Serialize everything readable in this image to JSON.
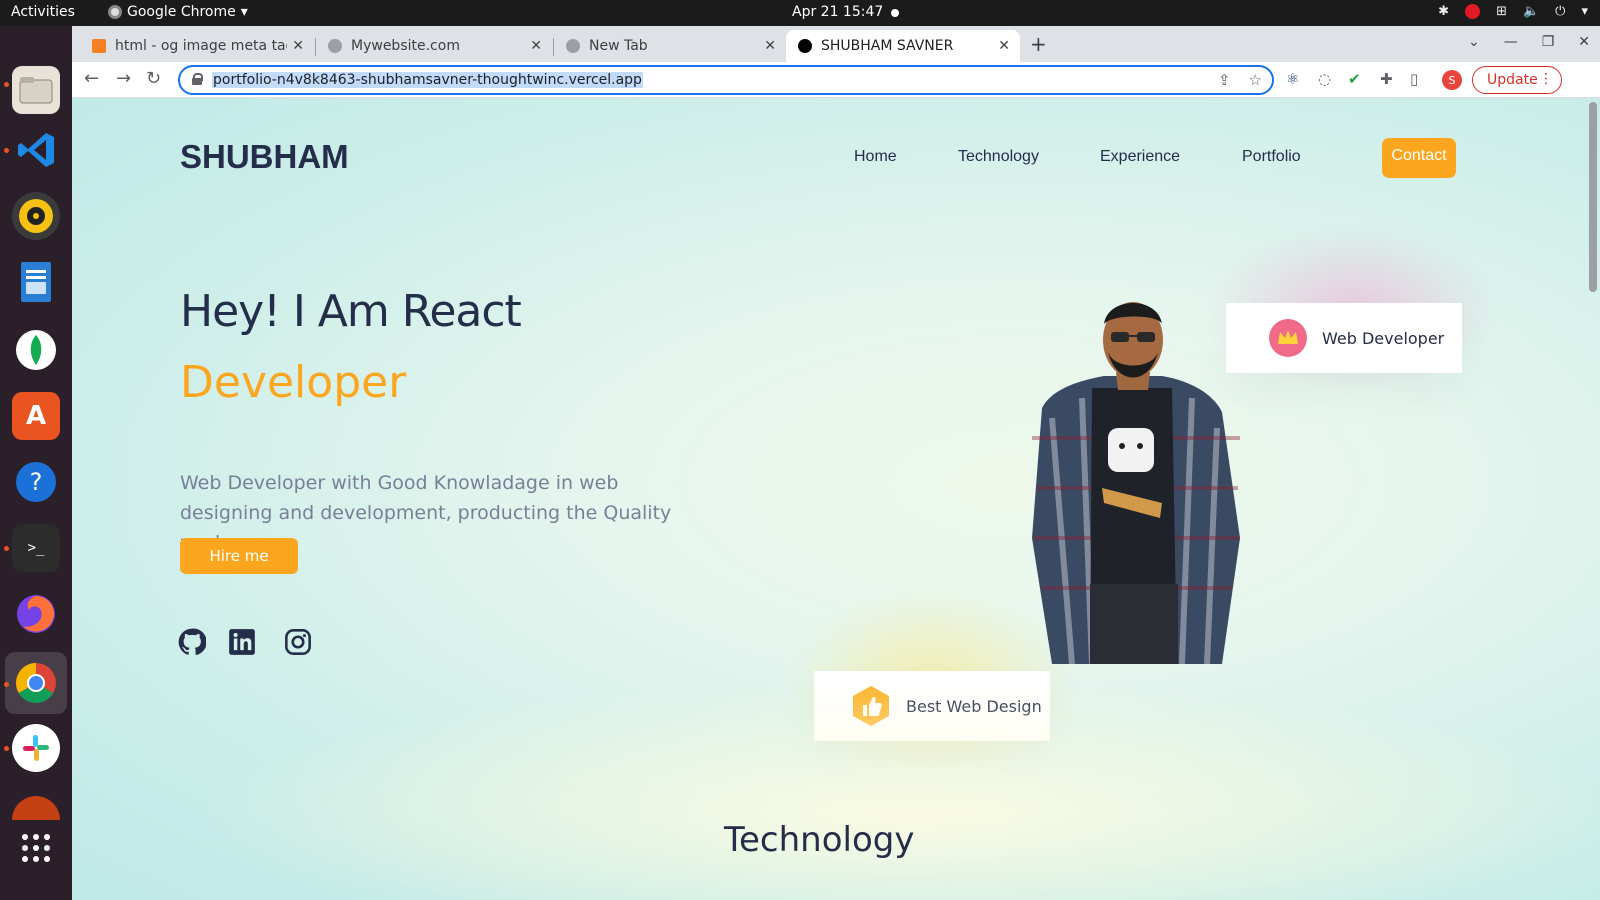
{
  "topbar": {
    "activities": "Activities",
    "app_name": "Google Chrome",
    "clock": "Apr 21  15:47"
  },
  "browser": {
    "tabs": [
      {
        "title": "html - og image meta tag"
      },
      {
        "title": "Mywebsite.com"
      },
      {
        "title": "New Tab"
      },
      {
        "title": "SHUBHAM SAVNER",
        "active": true
      }
    ],
    "url": "portfolio-n4v8k8463-shubhamsavner-thoughtwinc.vercel.app",
    "profile_initial": "S",
    "update_label": "Update"
  },
  "site": {
    "brand": "SHUBHAM",
    "nav": [
      "Home",
      "Technology",
      "Experience",
      "Portfolio"
    ],
    "contact_label": "Contact",
    "hero_line1": "Hey! I Am React",
    "hero_line2": "Developer",
    "hero_desc": "Web Developer with Good Knowladage in web designing and development, producting the Quality work",
    "hire_label": "Hire me",
    "card_top": "Web Developer",
    "card_bottom": "Best Web Design",
    "section_title": "Technology"
  },
  "colors": {
    "accent": "#fca61f",
    "dark_text": "#242d49",
    "muted_text": "#788097",
    "chrome_focus": "#1a73e8",
    "update_red": "#d93025"
  }
}
